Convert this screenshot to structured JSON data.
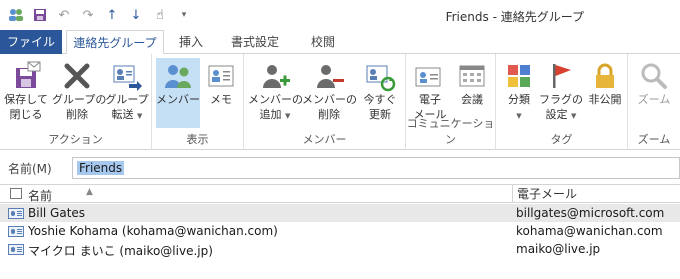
{
  "window": {
    "title": "Friends - 連絡先グループ"
  },
  "tabs": [
    {
      "label": "ファイル"
    },
    {
      "label": "連絡先グループ"
    },
    {
      "label": "挿入"
    },
    {
      "label": "書式設定"
    },
    {
      "label": "校閲"
    }
  ],
  "ribbon": {
    "groups": {
      "action": "アクション",
      "display": "表示",
      "member": "メンバー",
      "communication": "コミュニケーション",
      "tags": "タグ",
      "zoom": "ズーム"
    },
    "buttons": {
      "save_close": [
        "保存して",
        "閉じる"
      ],
      "delete_group": [
        "グループの",
        "削除"
      ],
      "forward_group": [
        "グループ",
        "転送"
      ],
      "members": [
        "メンバー"
      ],
      "notes": [
        "メモ"
      ],
      "add_members": [
        "メンバーの",
        "追加"
      ],
      "remove_member": [
        "メンバーの",
        "削除"
      ],
      "update_now": [
        "今すぐ",
        "更新"
      ],
      "email": [
        "電子",
        "メール"
      ],
      "meeting": [
        "会議"
      ],
      "categorize": [
        "分類"
      ],
      "follow_up": [
        "フラグの",
        "設定"
      ],
      "private": [
        "非公開"
      ],
      "zoom": [
        "ズーム"
      ]
    }
  },
  "name_field": {
    "label": "名前(M)",
    "value": "Friends"
  },
  "list": {
    "headers": {
      "name": "名前",
      "email": "電子メール"
    },
    "rows": [
      {
        "name": "Bill Gates",
        "email": "billgates@microsoft.com",
        "selected": true
      },
      {
        "name": "Yoshie Kohama (kohama@wanichan.com)",
        "email": "kohama@wanichan.com",
        "selected": false
      },
      {
        "name": "マイクロ まいこ (maiko@live.jp)",
        "email": "maiko@live.jp",
        "selected": false
      }
    ]
  },
  "colors": {
    "accent": "#2b579a",
    "selected_button": "#c5dff5",
    "selected_row": "#e8e8e8",
    "name_highlight": "#a6c8ee"
  }
}
